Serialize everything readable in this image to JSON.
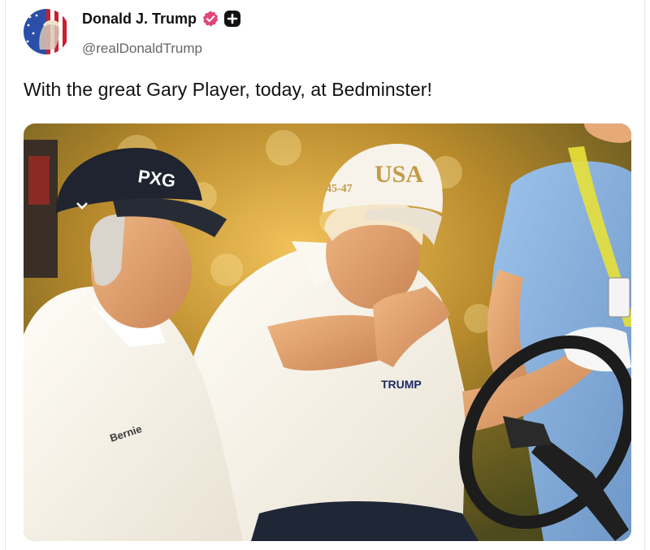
{
  "post": {
    "author": {
      "display_name": "Donald J. Trump",
      "handle": "@realDonaldTrump",
      "avatar_icon": "flag-portrait-avatar",
      "verified_icon": "verified-badge-icon",
      "verified_color": "#e0457b",
      "plus_icon": "plus-badge-icon"
    },
    "text": "With the great Gary Player, today, at Bedminster!",
    "image": {
      "cap_left_logo": "PXG",
      "cap_right_text": "USA",
      "cap_right_number": "45-47",
      "shirt_right_text": "TRUMP",
      "shirt_left_text": "Bernie"
    }
  }
}
